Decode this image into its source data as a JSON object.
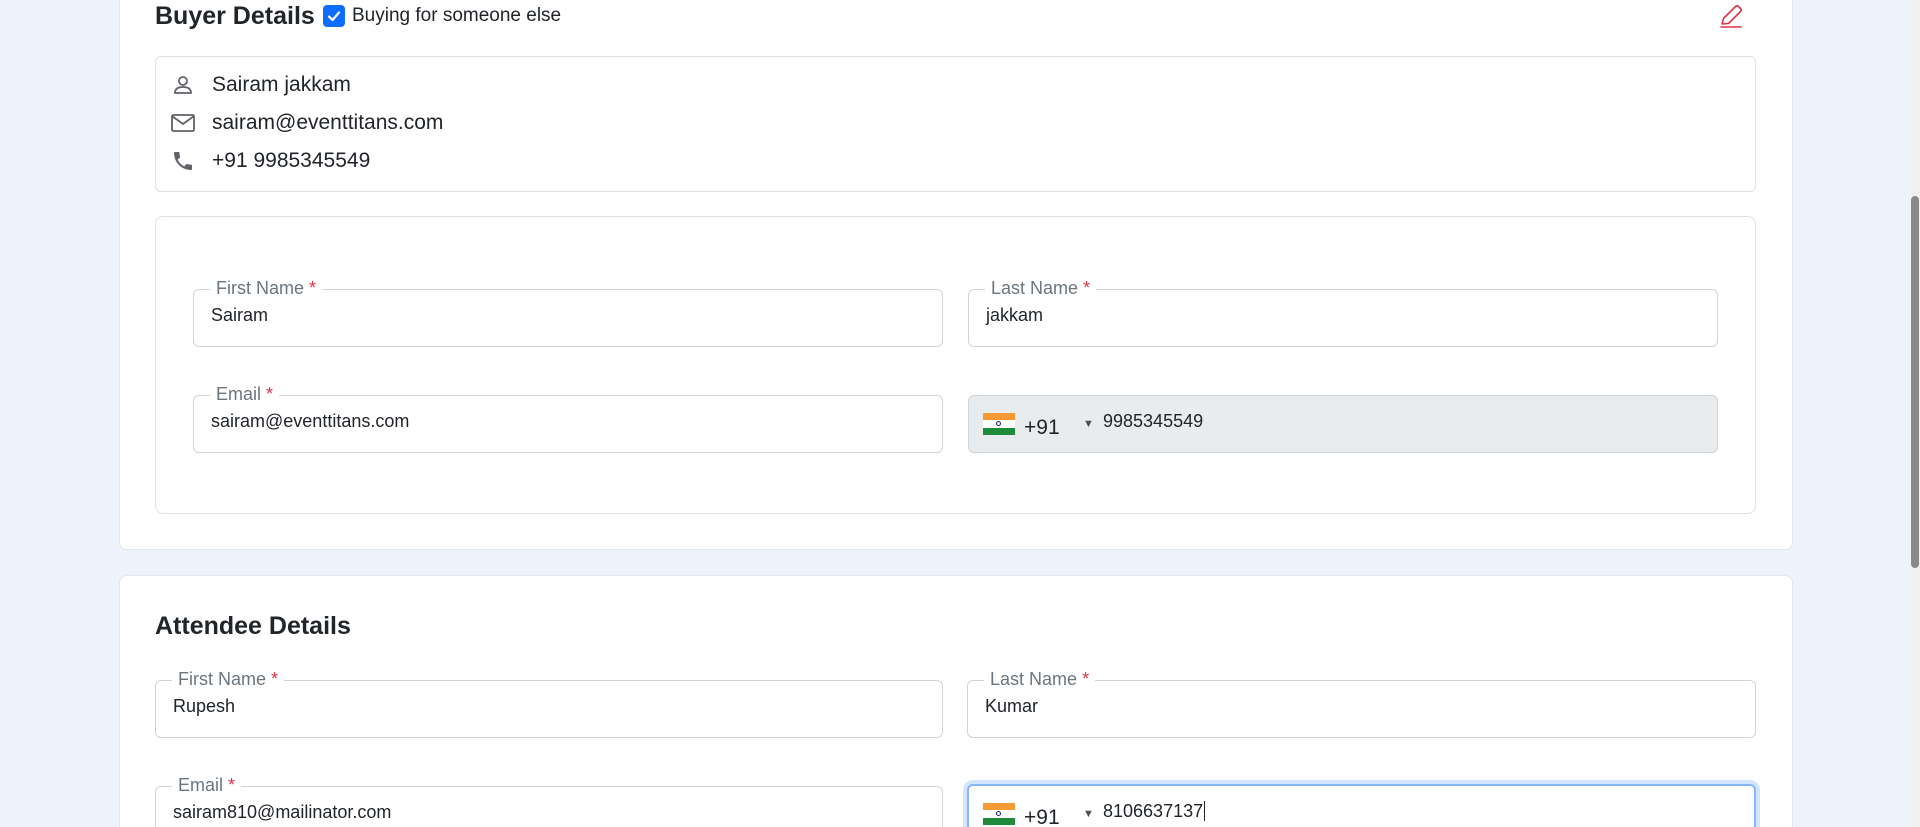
{
  "buyer": {
    "title": "Buyer Details",
    "buying_for_someone_else_label": "Buying for someone else",
    "buying_for_someone_else_checked": true,
    "summary": {
      "name": "Sairam jakkam",
      "email": "sairam@eventtitans.com",
      "phone": "+91 9985345549"
    },
    "form": {
      "first_name_label": "First Name",
      "first_name_value": "Sairam",
      "last_name_label": "Last Name",
      "last_name_value": "jakkam",
      "email_label": "Email",
      "email_value": "sairam@eventtitans.com",
      "phone_code": "+91",
      "phone_value": "9985345549",
      "required_mark": "*"
    }
  },
  "attendee": {
    "title": "Attendee Details",
    "form": {
      "first_name_label": "First Name",
      "first_name_value": "Rupesh",
      "last_name_label": "Last Name",
      "last_name_value": "Kumar",
      "email_label": "Email",
      "email_value": "sairam810@mailinator.com",
      "phone_code": "+91",
      "phone_value": "8106637137",
      "required_mark": "*"
    }
  },
  "icons": {
    "edit": "pencil-icon",
    "person": "person-icon",
    "mail": "mail-icon",
    "phone": "phone-icon",
    "check": "check-icon",
    "flag": "india-flag-icon",
    "caret": "caret-down-icon"
  },
  "colors": {
    "page_bg": "#edf2fb",
    "accent": "#0d6efd",
    "required": "#dc3545",
    "edit_icon": "#dc3545"
  }
}
